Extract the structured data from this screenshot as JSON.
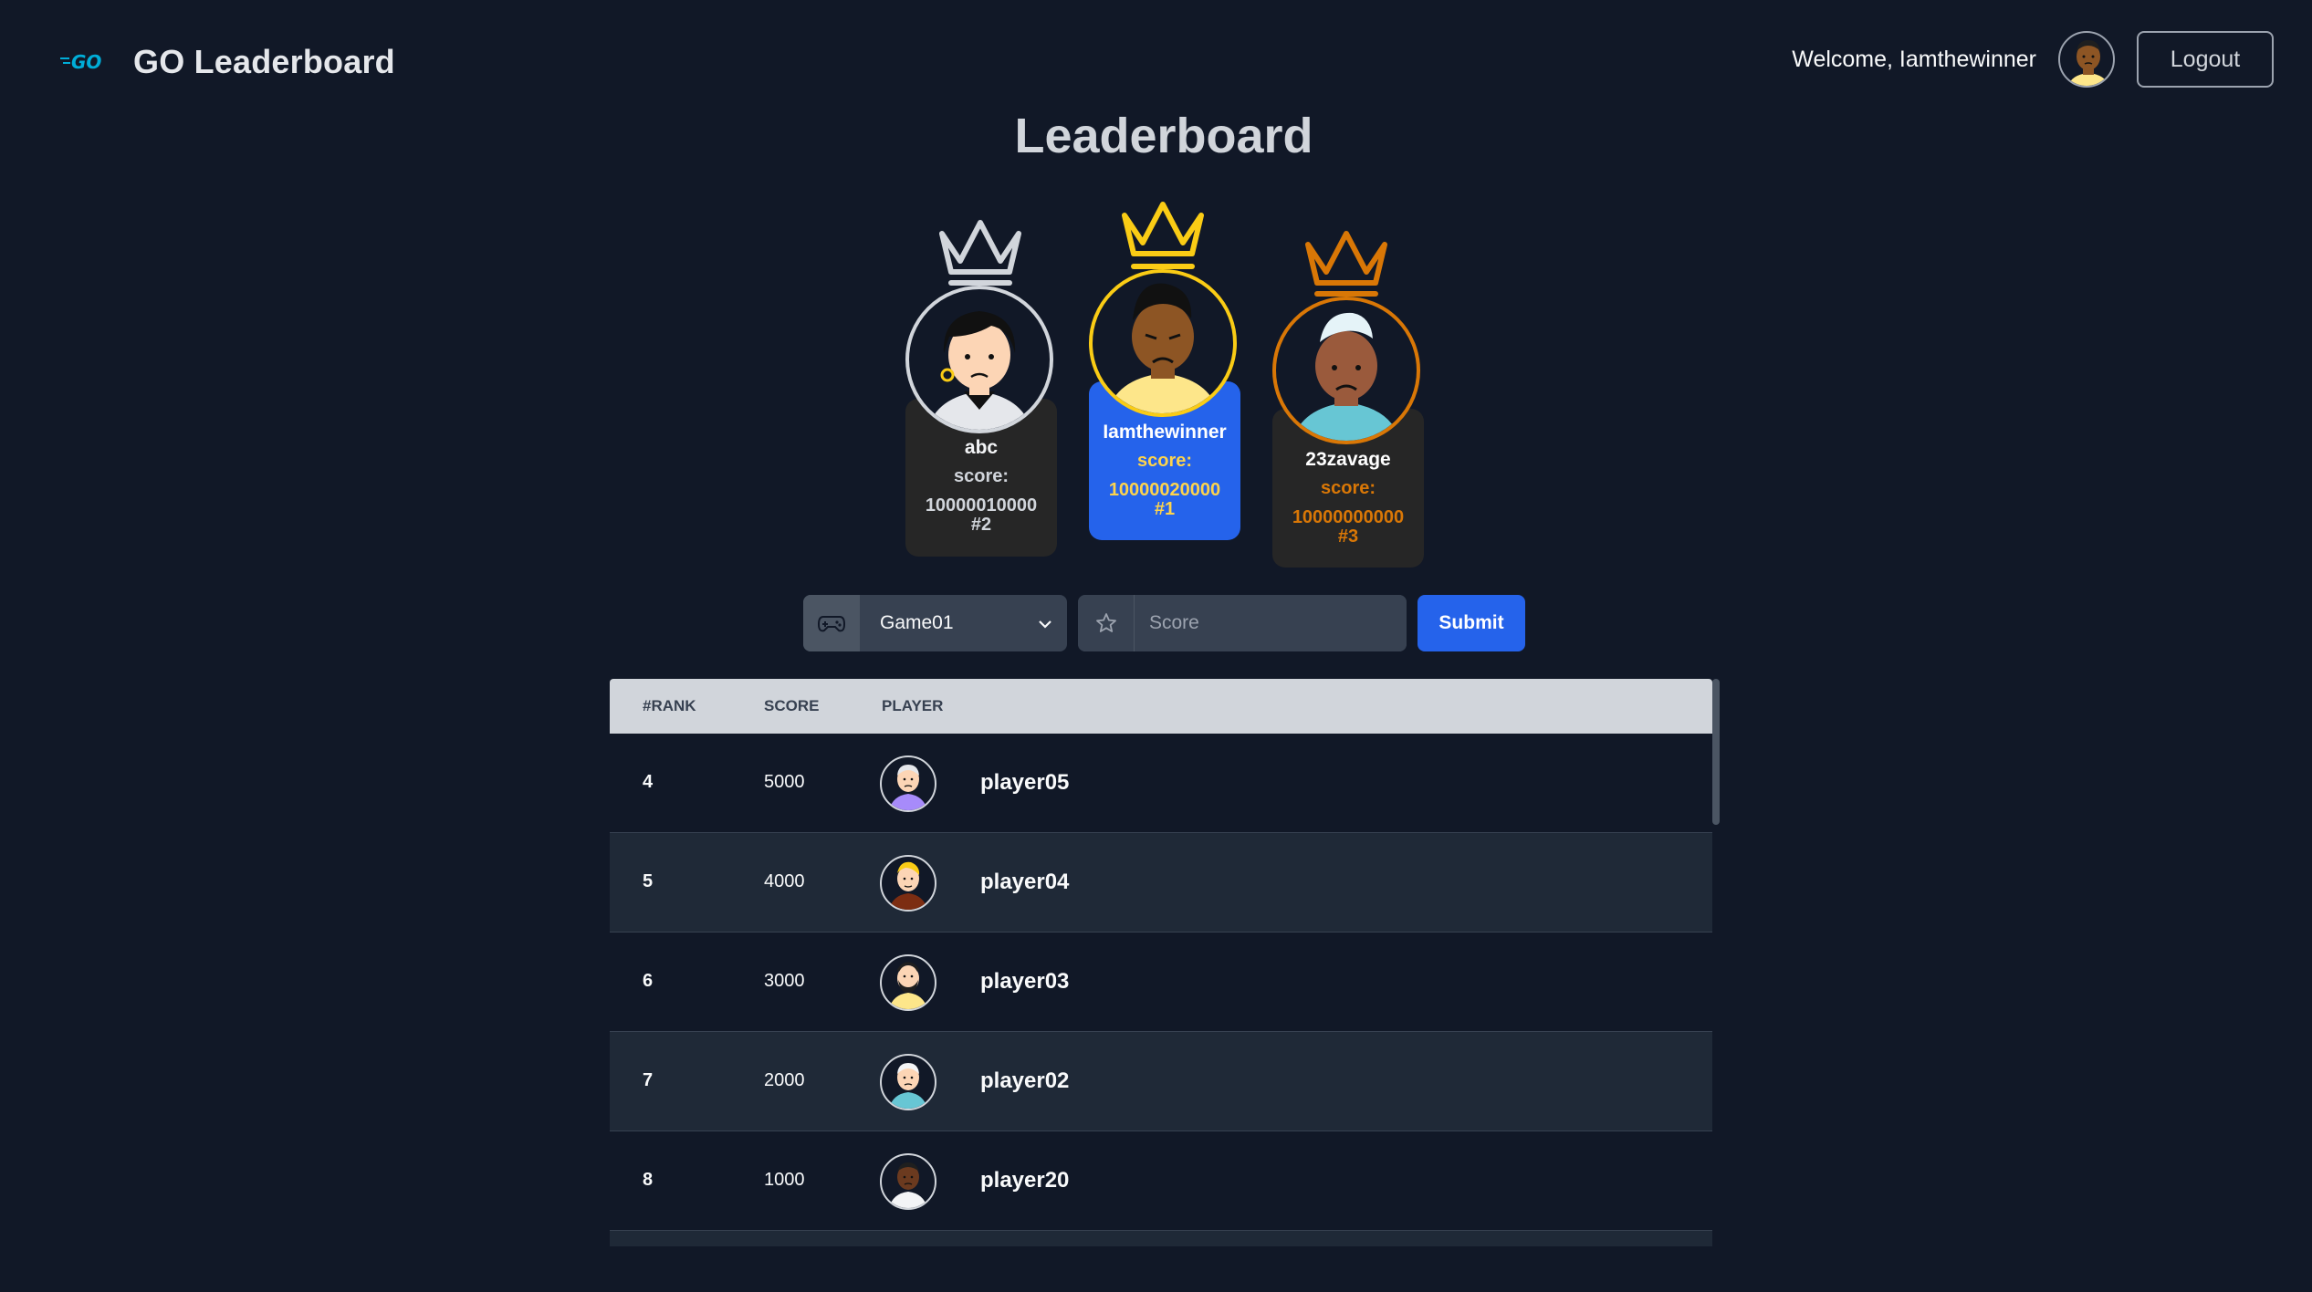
{
  "header": {
    "brand_logo_text": "GO",
    "brand_title": "GO Leaderboard",
    "welcome_text": "Welcome, Iamthewinner",
    "logout_label": "Logout"
  },
  "page_title": "Leaderboard",
  "podium": {
    "first": {
      "name": "Iamthewinner",
      "score_label": "score:",
      "score": "10000020000",
      "rank": "#1",
      "crown_color": "#facc15"
    },
    "second": {
      "name": "abc",
      "score_label": "score:",
      "score": "10000010000",
      "rank": "#2",
      "crown_color": "#d1d5db"
    },
    "third": {
      "name": "23zavage",
      "score_label": "score:",
      "score": "10000000000",
      "rank": "#3",
      "crown_color": "#d97706"
    }
  },
  "form": {
    "game_icon": "gamepad-icon",
    "selected_game": "Game01",
    "score_icon": "star-icon",
    "score_placeholder": "Score",
    "submit_label": "Submit"
  },
  "table": {
    "headers": {
      "rank": "#RANK",
      "score": "SCORE",
      "player": "PLAYER"
    },
    "rows": [
      {
        "rank": "4",
        "score": "5000",
        "player": "player05"
      },
      {
        "rank": "5",
        "score": "4000",
        "player": "player04"
      },
      {
        "rank": "6",
        "score": "3000",
        "player": "player03"
      },
      {
        "rank": "7",
        "score": "2000",
        "player": "player02"
      },
      {
        "rank": "8",
        "score": "1000",
        "player": "player20"
      }
    ]
  },
  "colors": {
    "background": "#111827",
    "accent": "#2563eb",
    "gold": "#facc15",
    "silver": "#d1d5db",
    "bronze": "#d97706"
  }
}
